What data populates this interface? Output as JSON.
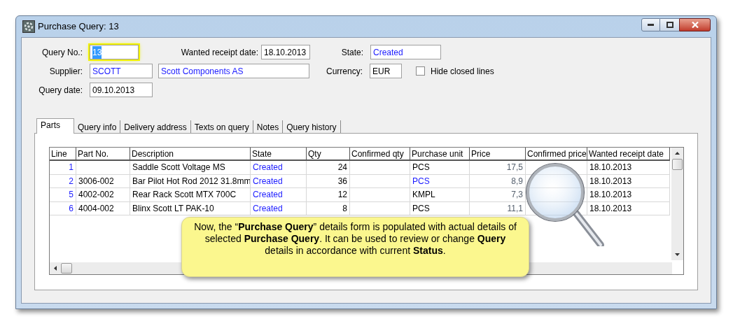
{
  "window": {
    "title": "Purchase Query: 13"
  },
  "header": {
    "query_no": {
      "label": "Query No.:",
      "value": "13",
      "highlighted": true
    },
    "wanted_receipt_date": {
      "label": "Wanted receipt date:",
      "value": "18.10.2013"
    },
    "state": {
      "label": "State:",
      "value": "Created"
    },
    "supplier": {
      "label": "Supplier:",
      "value": "SCOTT",
      "name": "Scott Components AS"
    },
    "currency": {
      "label": "Currency:",
      "value": "EUR"
    },
    "hide_closed_lines": {
      "label": "Hide closed lines",
      "checked": false
    },
    "query_date": {
      "label": "Query date:",
      "value": "09.10.2013"
    }
  },
  "tabs": [
    {
      "label": "Parts",
      "selected": true
    },
    {
      "label": "Query info",
      "selected": false
    },
    {
      "label": "Delivery address",
      "selected": false
    },
    {
      "label": "Texts on query",
      "selected": false
    },
    {
      "label": "Notes",
      "selected": false
    },
    {
      "label": "Query history",
      "selected": false
    }
  ],
  "table": {
    "columns": [
      "Line",
      "Part No.",
      "Description",
      "State",
      "Qty",
      "Confirmed qty",
      "Purchase unit",
      "Price",
      "Confirmed price",
      "Wanted receipt date"
    ],
    "rows": [
      {
        "line": "1",
        "part_no": "",
        "description": "Saddle Scott Voltage MS",
        "state": "Created",
        "qty": "24",
        "purchase_unit": "PCS",
        "unit_linked": false,
        "price": "17,5",
        "wanted_receipt_date": "18.10.2013"
      },
      {
        "line": "2",
        "part_no": "3006-002",
        "description": "Bar Pilot Hot Rod 2012 31.8mm",
        "state": "Created",
        "qty": "36",
        "purchase_unit": "PCS",
        "unit_linked": true,
        "price": "8,9",
        "wanted_receipt_date": "18.10.2013"
      },
      {
        "line": "5",
        "part_no": "4002-002",
        "description": "Rear Rack Scott MTX 700C",
        "state": "Created",
        "qty": "12",
        "purchase_unit": "KMPL",
        "unit_linked": false,
        "price": "7,3",
        "wanted_receipt_date": "18.10.2013"
      },
      {
        "line": "6",
        "part_no": "4004-002",
        "description": "Blinx Scott LT PAK-10",
        "state": "Created",
        "qty": "8",
        "purchase_unit": "PCS",
        "unit_linked": false,
        "price": "11,1",
        "wanted_receipt_date": "18.10.2013"
      }
    ]
  },
  "callout": {
    "text": "Now, the “**Purchase Query**” details form is populated with actual details of selected **Purchase Query**.  It can be used to review or change **Query** details in accordance with current **Status**."
  }
}
